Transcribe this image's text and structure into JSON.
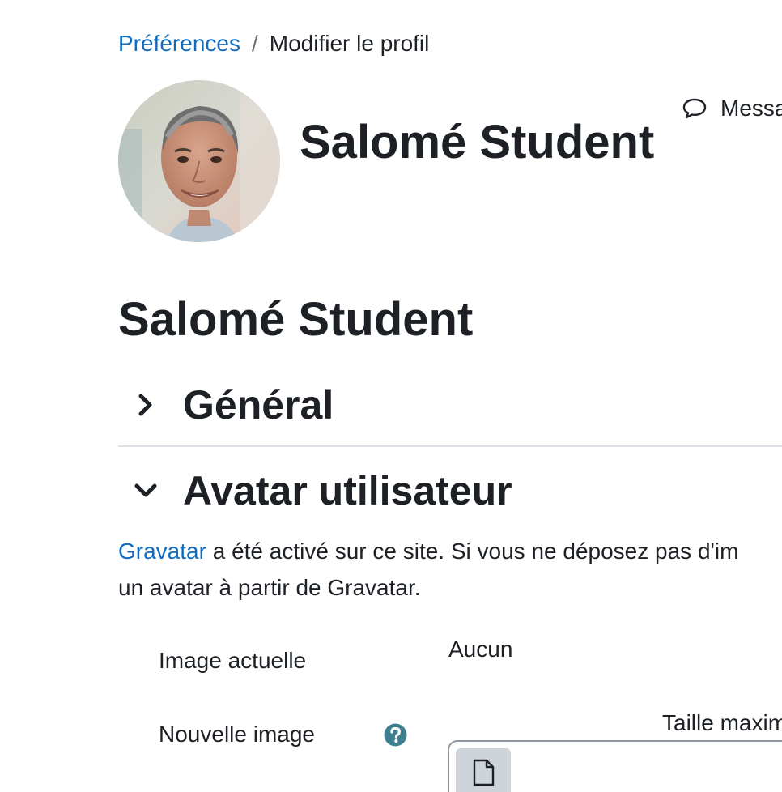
{
  "breadcrumb": {
    "parent": "Préférences",
    "separator": "/",
    "current": "Modifier le profil"
  },
  "header": {
    "name": "Salomé Student",
    "message_label": "Messa",
    "avatar_icon": "user-photo"
  },
  "page_title": "Salomé Student",
  "sections": {
    "general": {
      "title": "Général",
      "expanded": false
    },
    "avatar": {
      "title": "Avatar utilisateur",
      "expanded": true
    }
  },
  "gravatar_info": {
    "link": "Gravatar",
    "line1_rest": " a été activé sur ce site. Si vous ne déposez pas d'im",
    "line2": "un avatar à partir de Gravatar."
  },
  "form": {
    "current_image_label": "Image actuelle",
    "current_image_value": "Aucun",
    "new_image_label": "Nouvelle image",
    "max_size_label": "Taille maxim"
  },
  "colors": {
    "link": "#0f6cbf",
    "text": "#1d2125",
    "help_icon": "#3d7f8f",
    "divider": "#dee2e6"
  }
}
